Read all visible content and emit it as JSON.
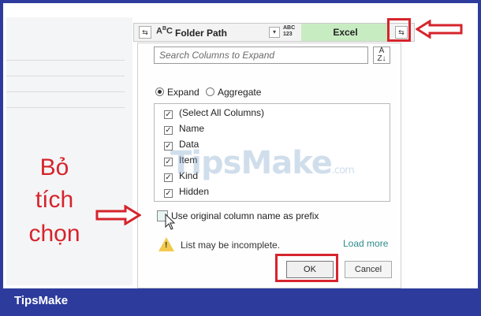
{
  "header": {
    "column_title": "Folder Path",
    "type_icon_text": "ABC 123",
    "excel_column": "Excel"
  },
  "dialog": {
    "search_placeholder": "Search Columns to Expand",
    "options": {
      "expand": "Expand",
      "aggregate": "Aggregate",
      "selected": "expand"
    },
    "columns": [
      {
        "label": "(Select All Columns)",
        "checked": true
      },
      {
        "label": "Name",
        "checked": true
      },
      {
        "label": "Data",
        "checked": true
      },
      {
        "label": "Item",
        "checked": true
      },
      {
        "label": "Kind",
        "checked": true
      },
      {
        "label": "Hidden",
        "checked": true
      }
    ],
    "prefix_label": "Use original column name as prefix",
    "prefix_checked": false,
    "warning": "List may be incomplete.",
    "load_more": "Load more",
    "ok_label": "OK",
    "cancel_label": "Cancel"
  },
  "annotation": {
    "line1": "Bỏ",
    "line2": "tích",
    "line3": "chọn",
    "color": "#d6242c"
  },
  "watermark": {
    "text": "TipsMake",
    "suffix": ".com"
  },
  "footer": {
    "brand": "TipsMake",
    "color": "#2d3c9c"
  }
}
